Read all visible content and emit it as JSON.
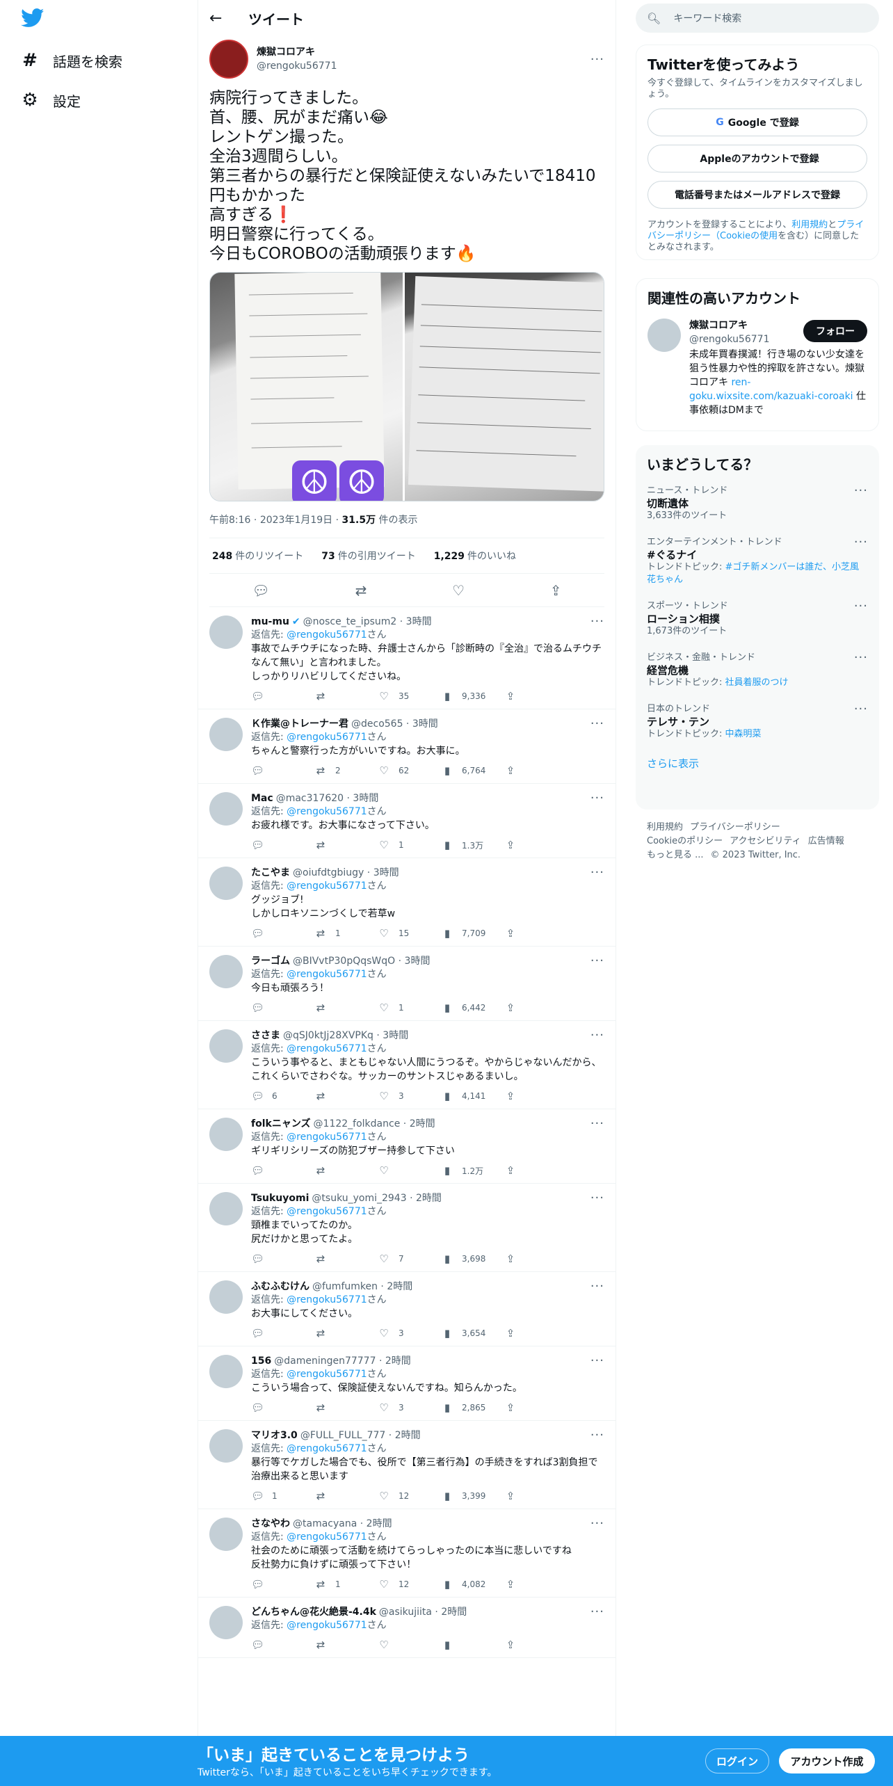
{
  "nav": {
    "explore_label": "話題を検索",
    "settings_label": "設定"
  },
  "header": {
    "title": "ツイート"
  },
  "tweet": {
    "name": "煉獄コロアキ",
    "handle": "@rengoku56771",
    "text": "病院行ってきました。\n首、腰、尻がまだ痛い😂\nレントゲン撮った。\n全治3週間らしい。\n第三者からの暴行だと保険証使えないみたいで18410円もかかった\n高すぎる❗️\n明日警察に行ってくる。\n今日もCOROBOの活動頑張ります🔥",
    "time": "午前8:16",
    "date": "2023年1月19日",
    "views_count": "31.5万",
    "views_label": "件の表示",
    "retweets_count": "248",
    "retweets_label": "件のリツイート",
    "quotes_count": "73",
    "quotes_label": "件の引用ツイート",
    "likes_count": "1,229",
    "likes_label": "件のいいね"
  },
  "reply_prefix": "返信先: ",
  "reply_suffix": "さん",
  "replies": [
    {
      "name": "mu-mu",
      "handle": "@nosce_te_ipsum2",
      "time": "3時間",
      "to": "@rengoku56771",
      "text": "事故でムチウチになった時、弁護士さんから「診断時の『全治』で治るムチウチなんて無い」と言われました。\nしっかりリハビリしてくださいね。",
      "replies": "",
      "retweets": "",
      "likes": "35",
      "views": "9,336",
      "verified": true
    },
    {
      "name": "Ｋ作業@トレーナー君",
      "handle": "@deco565",
      "time": "3時間",
      "to": "@rengoku56771",
      "text": "ちゃんと警察行った方がいいですね。お大事に。",
      "replies": "",
      "retweets": "2",
      "likes": "62",
      "views": "6,764"
    },
    {
      "name": "Mac",
      "handle": "@mac317620",
      "time": "3時間",
      "to": "@rengoku56771",
      "text": "お疲れ様です。お大事になさって下さい。",
      "replies": "",
      "retweets": "",
      "likes": "1",
      "views": "1.3万"
    },
    {
      "name": "たこやま",
      "handle": "@oiufdtgbiugy",
      "time": "3時間",
      "to": "@rengoku56771",
      "text": "グッジョブ!\nしかしロキソニンづくしで若草w",
      "replies": "",
      "retweets": "1",
      "likes": "15",
      "views": "7,709"
    },
    {
      "name": "ラーゴム",
      "handle": "@BIVvtP30pQqsWqO",
      "time": "3時間",
      "to": "@rengoku56771",
      "text": "今日も頑張ろう！",
      "replies": "",
      "retweets": "",
      "likes": "1",
      "views": "6,442"
    },
    {
      "name": "ささま",
      "handle": "@qSJ0ktJj28XVPKq",
      "time": "3時間",
      "to": "@rengoku56771",
      "text": "こういう事やると、まともじゃない人間にうつるぞ。やからじゃないんだから、これくらいでさわぐな。サッカーのサントスじゃあるまいし。",
      "replies": "6",
      "retweets": "",
      "likes": "3",
      "views": "4,141"
    },
    {
      "name": "folkニャンズ",
      "handle": "@1122_folkdance",
      "time": "2時間",
      "to": "@rengoku56771",
      "text": "ギリギリシリーズの防犯ブザー持参して下さい",
      "replies": "",
      "retweets": "",
      "likes": "",
      "views": "1.2万"
    },
    {
      "name": "Tsukuyomi",
      "handle": "@tsuku_yomi_2943",
      "time": "2時間",
      "to": "@rengoku56771",
      "text": "頸椎までいってたのか。\n尻だけかと思ってたよ。",
      "replies": "",
      "retweets": "",
      "likes": "7",
      "views": "3,698"
    },
    {
      "name": "ふむふむけん",
      "handle": "@fumfumken",
      "time": "2時間",
      "to": "@rengoku56771",
      "text": "お大事にしてください。",
      "replies": "",
      "retweets": "",
      "likes": "3",
      "views": "3,654"
    },
    {
      "name": "156",
      "handle": "@dameningen77777",
      "time": "2時間",
      "to": "@rengoku56771",
      "text": "こういう場合って、保険証使えないんですね。知らんかった。",
      "replies": "",
      "retweets": "",
      "likes": "3",
      "views": "2,865"
    },
    {
      "name": "マリオ3.0",
      "handle": "@FULL_FULL_777",
      "time": "2時間",
      "to": "@rengoku56771",
      "text": "暴行等でケガした場合でも、役所で【第三者行為】の手続きをすれば3割負担で治療出来ると思います",
      "replies": "1",
      "retweets": "",
      "likes": "12",
      "views": "3,399"
    },
    {
      "name": "さなやわ",
      "handle": "@tamacyana",
      "time": "2時間",
      "to": "@rengoku56771",
      "text": "社会のために頑張って活動を続けてらっしゃったのに本当に悲しいですね\n反社勢力に負けずに頑張って下さい！",
      "replies": "",
      "retweets": "1",
      "likes": "12",
      "views": "4,082"
    },
    {
      "name": "どんちゃん@花火絶景-4.4k",
      "handle": "@asikujiita",
      "time": "2時間",
      "to": "@rengoku56771",
      "text": "",
      "replies": "",
      "retweets": "",
      "likes": "",
      "views": ""
    }
  ],
  "search": {
    "placeholder": "キーワード検索"
  },
  "signup_box": {
    "title": "Twitterを使ってみよう",
    "desc": "今すぐ登録して、タイムラインをカスタマイズしましょう。",
    "google": "Google で登録",
    "apple": "Appleのアカウントで登録",
    "email": "電話番号またはメールアドレスで登録",
    "legal_1": "アカウントを登録することにより、",
    "legal_terms": "利用規約",
    "legal_2": "と",
    "legal_privacy": "プライバシーポリシー（Cookieの使用",
    "legal_3": "を含む）に同意したとみなされます。"
  },
  "related": {
    "title": "関連性の高いアカウント",
    "name": "煉獄コロアキ",
    "handle": "@rengoku56771",
    "follow": "フォロー",
    "bio": "未成年買春撲滅！行き場のない少女達を狙う性暴力や性的搾取を許さない。煉獄コロアキ ",
    "bio_link": "ren-goku.wixsite.com/kazuaki-coroaki",
    "bio_end": " 仕事依頼はDMまで"
  },
  "trends": {
    "title": "いまどうしてる？",
    "items": [
      {
        "cat": "ニュース・トレンド",
        "name": "切断遺体",
        "sub": "3,633件のツイート",
        "topic_prefix": "",
        "topic": ""
      },
      {
        "cat": "エンターテインメント・トレンド",
        "name": "#ぐるナイ",
        "sub": "",
        "topic_prefix": "トレンドトピック: ",
        "topic": "#ゴチ新メンバーは誰だ、小芝風花ちゃん"
      },
      {
        "cat": "スポーツ・トレンド",
        "name": "ローション相撲",
        "sub": "1,673件のツイート",
        "topic_prefix": "",
        "topic": ""
      },
      {
        "cat": "ビジネス・金融・トレンド",
        "name": "経営危機",
        "sub": "",
        "topic_prefix": "トレンドトピック: ",
        "topic": "社員着服のつけ"
      },
      {
        "cat": "日本のトレンド",
        "name": "テレサ・テン",
        "sub": "",
        "topic_prefix": "トレンドトピック: ",
        "topic": "中森明菜"
      }
    ],
    "show_more": "さらに表示"
  },
  "footer": {
    "links1": [
      "利用規約",
      "プライバシーポリシー"
    ],
    "links2": [
      "Cookieのポリシー",
      "アクセシビリティ",
      "広告情報"
    ],
    "more": "もっと見る ...",
    "copyright": "© 2023 Twitter, Inc."
  },
  "bottom_bar": {
    "headline": "「いま」起きていることを見つけよう",
    "sub": "Twitterなら、「いま」起きていることをいち早くチェックできます。",
    "login": "ログイン",
    "signup": "アカウント作成"
  },
  "colors": {
    "accent": "#1d9bf0",
    "text": "#0f1419",
    "muted": "#536471"
  }
}
